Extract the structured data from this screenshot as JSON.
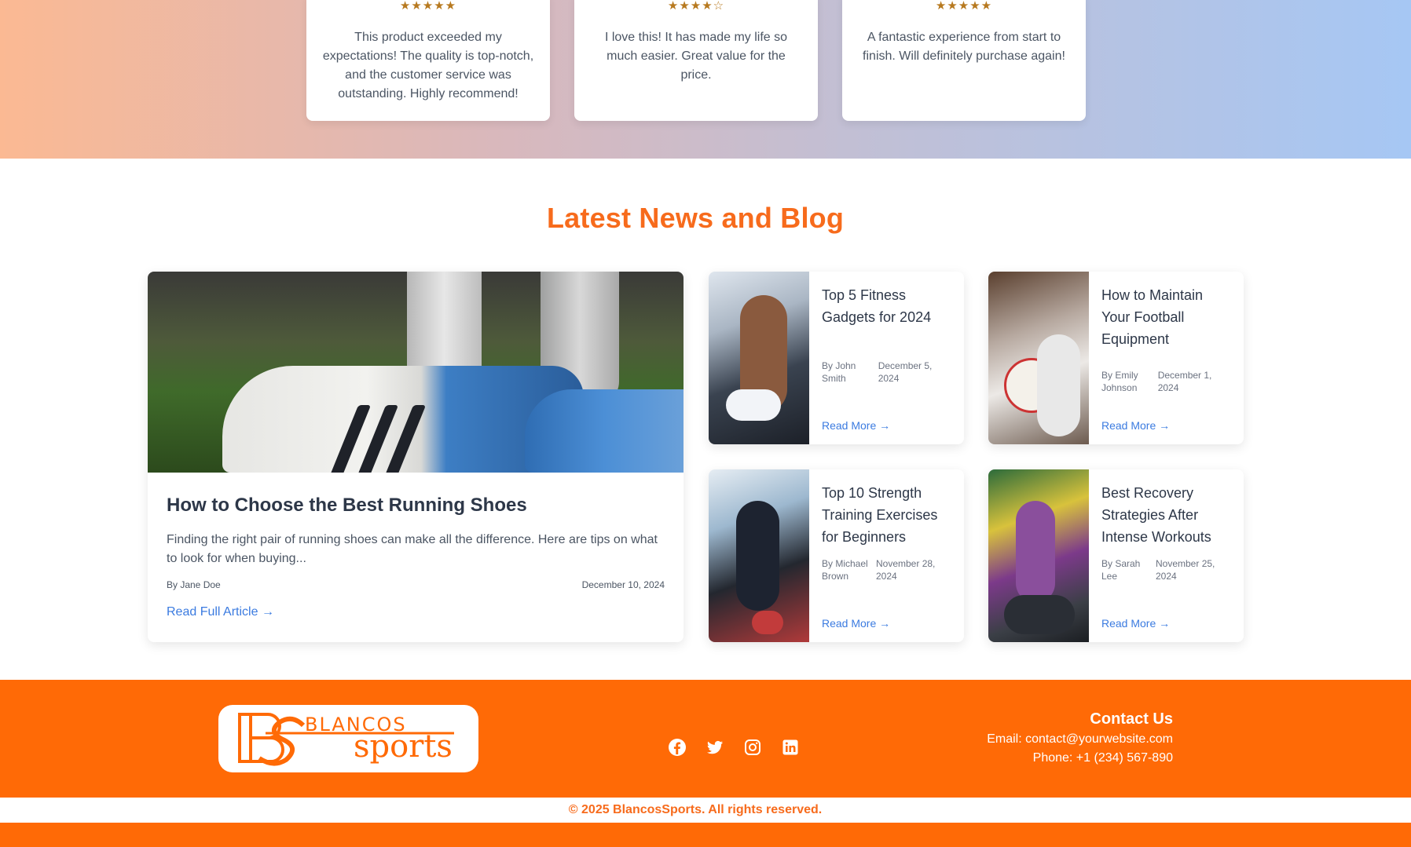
{
  "testimonials": [
    {
      "stars": "★★★★★",
      "rating": 5,
      "quote": "This product exceeded my expectations! The quality is top-notch, and the customer service was outstanding. Highly recommend!"
    },
    {
      "stars": "★★★★☆",
      "rating": 4,
      "quote": "I love this! It has made my life so much easier. Great value for the price."
    },
    {
      "stars": "★★★★★",
      "rating": 5,
      "quote": "A fantastic experience from start to finish. Will definitely purchase again!"
    }
  ],
  "blog": {
    "heading": "Latest News and Blog",
    "featured": {
      "image_icon": "running-shoes-photo",
      "title": "How to Choose the Best Running Shoes",
      "excerpt": "Finding the right pair of running shoes can make all the difference. Here are tips on what to look for when buying...",
      "author": "By Jane Doe",
      "date": "December 10, 2024",
      "link": "Read Full Article →"
    },
    "posts": [
      {
        "image_icon": "gym-training-photo",
        "title": "Top 5 Fitness Gadgets for 2024",
        "author": "By John Smith",
        "date": "December 5, 2024",
        "link": "Read More →"
      },
      {
        "image_icon": "football-kids-photo",
        "title": "How to Maintain Your Football Equipment",
        "author": "By Emily Johnson",
        "date": "December 1, 2024",
        "link": "Read More →"
      },
      {
        "image_icon": "strength-training-photo",
        "title": "Top 10 Strength Training Exercises for Beginners",
        "author": "By Michael Brown",
        "date": "November 28, 2024",
        "link": "Read More →"
      },
      {
        "image_icon": "recovery-athlete-photo",
        "title": "Best Recovery Strategies After Intense Workouts",
        "author": "By Sarah Lee",
        "date": "November 25, 2024",
        "link": "Read More →"
      }
    ]
  },
  "footer": {
    "logo": {
      "top": "BLANCOS",
      "bottom": "sports",
      "initials": "BS"
    },
    "socials": [
      "facebook-icon",
      "twitter-icon",
      "instagram-icon",
      "linkedin-icon"
    ],
    "contact_title": "Contact Us",
    "email": "Email: contact@yourwebsite.com",
    "phone": "Phone: +1 (234) 567-890",
    "copyright": "© 2025 BlancosSports. All rights reserved."
  },
  "colors": {
    "accent": "#f76b1c",
    "footer_bg": "#ff6a06",
    "link": "#3b7be0",
    "stars": "#b7791f"
  }
}
